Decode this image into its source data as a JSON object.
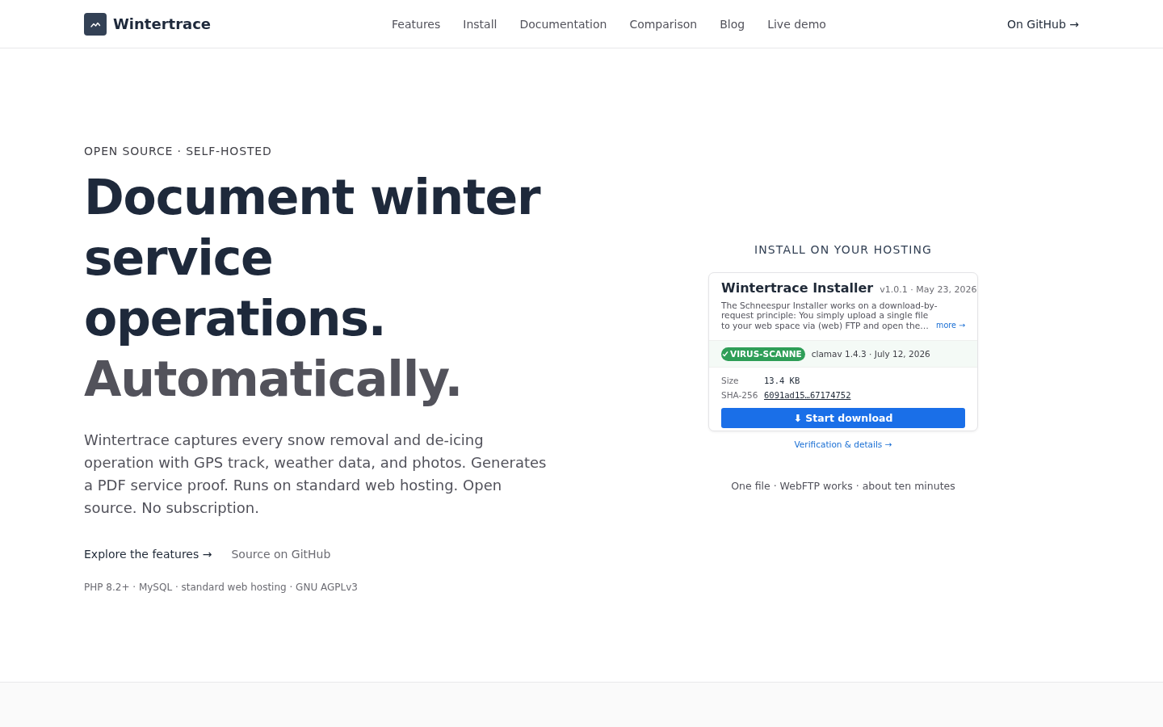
{
  "nav": {
    "brand": "Wintertrace",
    "links": [
      "Features",
      "Install",
      "Documentation",
      "Comparison",
      "Blog",
      "Live demo"
    ],
    "github_link": "On GitHub →"
  },
  "hero": {
    "eyebrow": "OPEN SOURCE · SELF-HOSTED",
    "headline": "Document winter service operations.",
    "headline_accent": "Automatically.",
    "lead": "Wintertrace captures every snow removal and de-icing operation with GPS track, weather data, and photos. Generates a PDF service proof. Runs on standard web hosting. Open source. No subscription.",
    "actions": [
      {
        "label": "Explore the features →",
        "kind": "primary"
      },
      {
        "label": "Source on GitHub",
        "kind": "secondary"
      }
    ],
    "tech_line": "PHP 8.2+ · MySQL · standard web hosting · GNU AGPLv3"
  },
  "install": {
    "heading": "INSTALL ON YOUR HOSTING",
    "card": {
      "title": "Wintertrace Installer",
      "version": "v1.0.1 · May 23, 2026",
      "description": "The Schneespur Installer works on a download-by-request principle: You simply upload a single file to your web space via (web) FTP and open the…",
      "more_link": "more →",
      "scan": {
        "badge": "VIRUS-SCANNE",
        "details": "clamav 1.4.3 · July 12, 2026"
      },
      "fields": [
        {
          "label": "Size",
          "value": "13.4 KB",
          "kind": "text"
        },
        {
          "label": "SHA-256",
          "value": "6091ad15…67174752",
          "kind": "link"
        }
      ],
      "download_button": "⬇ Start download"
    },
    "details_link": "Verification & details →",
    "note": "One file · WebFTP works · about ten minutes"
  }
}
